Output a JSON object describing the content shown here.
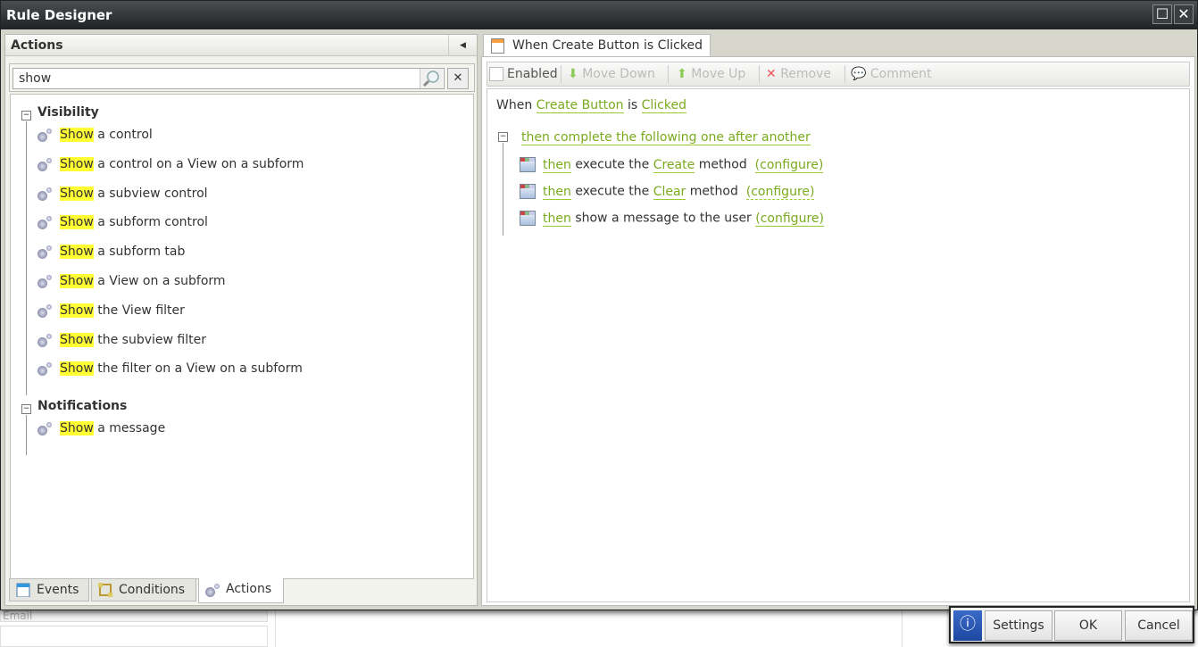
{
  "window": {
    "title": "Rule Designer"
  },
  "left_panel": {
    "title": "Actions",
    "search": {
      "value": "show",
      "placeholder": ""
    },
    "groups": [
      {
        "label": "Visibility",
        "items": [
          {
            "highlight": "Show",
            "rest": " a control"
          },
          {
            "highlight": "Show",
            "rest": " a control on a View on a subform"
          },
          {
            "highlight": "Show",
            "rest": " a subview control"
          },
          {
            "highlight": "Show",
            "rest": " a subform control"
          },
          {
            "highlight": "Show",
            "rest": " a subform tab"
          },
          {
            "highlight": "Show",
            "rest": " a View on a subform"
          },
          {
            "highlight": "Show",
            "rest": " the View filter"
          },
          {
            "highlight": "Show",
            "rest": " the subview filter"
          },
          {
            "highlight": "Show",
            "rest": " the filter on a View on a subform"
          }
        ]
      },
      {
        "label": "Notifications",
        "items": [
          {
            "highlight": "Show",
            "rest": " a message"
          }
        ]
      }
    ],
    "tabs": [
      {
        "label": "Events"
      },
      {
        "label": "Conditions"
      },
      {
        "label": "Actions",
        "active": true
      }
    ]
  },
  "right_panel": {
    "tab": "When Create Button is Clicked",
    "toolbar": {
      "enabled": "Enabled",
      "move_down": "Move Down",
      "move_up": "Move Up",
      "remove": "Remove",
      "comment": "Comment"
    },
    "rule": {
      "when": "When",
      "control": "Create Button",
      "is": "is",
      "event": "Clicked",
      "sequence": "then complete the following one after another",
      "actions": [
        {
          "then": "then",
          "pre": "execute the",
          "target": "Create",
          "post": "method",
          "configure": "(configure)"
        },
        {
          "then": "then",
          "pre": "execute the",
          "target": "Clear",
          "post": "method",
          "configure": "(configure)"
        },
        {
          "then": "then",
          "pre": "show a message to the user",
          "target": "",
          "post": "",
          "configure": "(configure)"
        }
      ]
    }
  },
  "footer": {
    "settings": "Settings",
    "ok": "OK",
    "cancel": "Cancel"
  },
  "background": {
    "field_label": "Email"
  }
}
